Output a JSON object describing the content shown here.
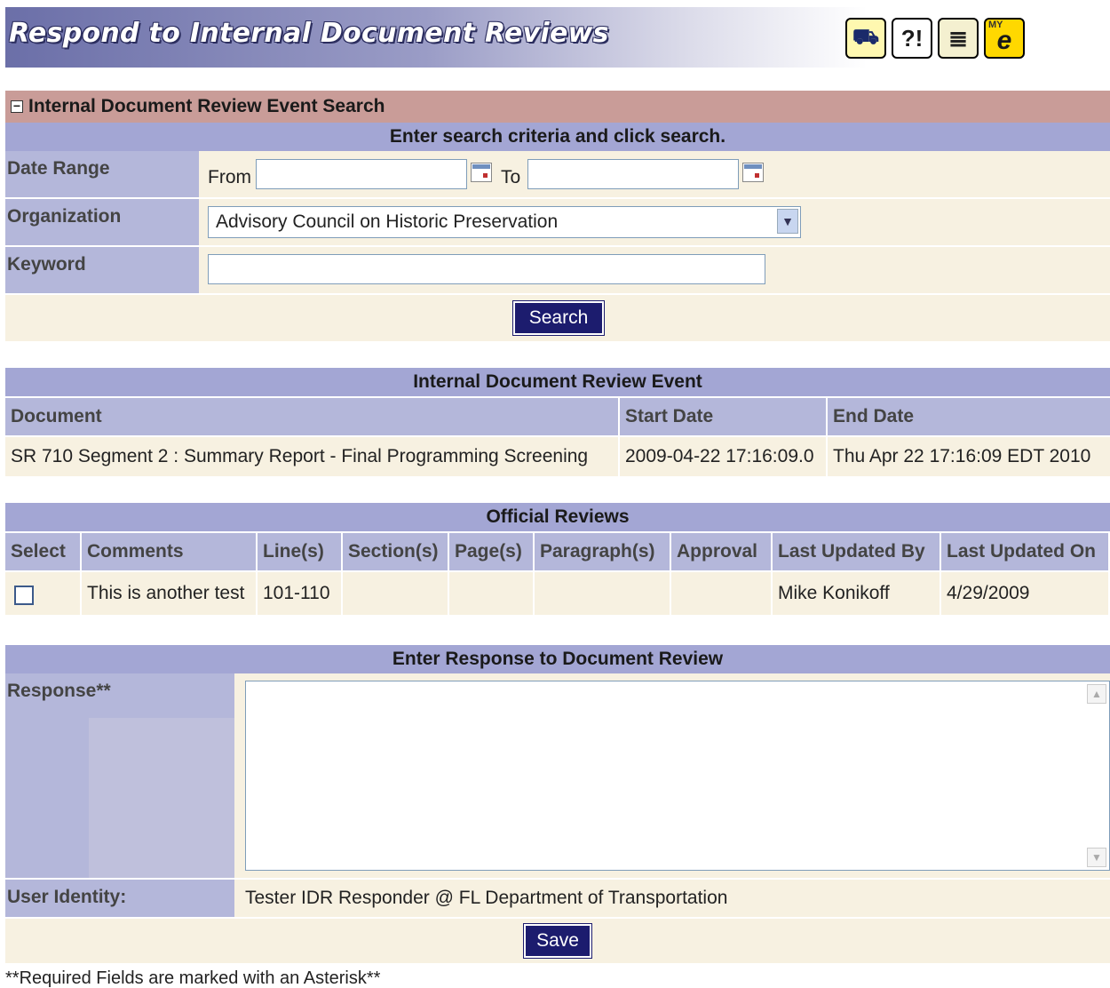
{
  "header": {
    "title": "Respond to Internal Document Reviews",
    "icons": [
      "map-icon",
      "help-icon",
      "add-document-icon",
      "my-e-icon"
    ],
    "icon_glyphs": [
      "⛟",
      "?!",
      "≣",
      "e"
    ],
    "my_label": "MY"
  },
  "search": {
    "title": "Internal Document Review Event Search",
    "instruction": "Enter search criteria and click search.",
    "date_range_label": "Date Range",
    "from_label": "From",
    "to_label": "To",
    "from_value": "",
    "to_value": "",
    "organization_label": "Organization",
    "organization_value": "Advisory Council on Historic Preservation",
    "keyword_label": "Keyword",
    "keyword_value": "",
    "search_button": "Search"
  },
  "event": {
    "title": "Internal Document Review Event",
    "columns": [
      "Document",
      "Start Date",
      "End Date"
    ],
    "row": {
      "document": "SR 710 Segment 2 : Summary Report - Final Programming Screening",
      "start_date": "2009-04-22 17:16:09.0",
      "end_date": "Thu Apr 22 17:16:09 EDT 2010"
    }
  },
  "reviews": {
    "title": "Official Reviews",
    "columns": [
      "Select",
      "Comments",
      "Line(s)",
      "Section(s)",
      "Page(s)",
      "Paragraph(s)",
      "Approval",
      "Last Updated By",
      "Last Updated On"
    ],
    "rows": [
      {
        "comments": "This is another test",
        "lines": "101-110",
        "sections": "",
        "pages": "",
        "paragraphs": "",
        "approval": "",
        "last_updated_by": "Mike Konikoff",
        "last_updated_on": "4/29/2009"
      }
    ]
  },
  "response": {
    "title": "Enter Response to Document Review",
    "response_label": "Response**",
    "response_value": "",
    "user_identity_label": "User Identity:",
    "user_identity_value": "Tester IDR Responder @ FL Department of Transportation",
    "save_button": "Save"
  },
  "footnote": "**Required Fields are marked with an Asterisk**",
  "colors": {
    "band": "#a3a6d4",
    "label_bg": "#b4b7da",
    "cream": "#f7f1e1",
    "search_title_bg": "#c99c98",
    "button": "#1c1c6e"
  }
}
